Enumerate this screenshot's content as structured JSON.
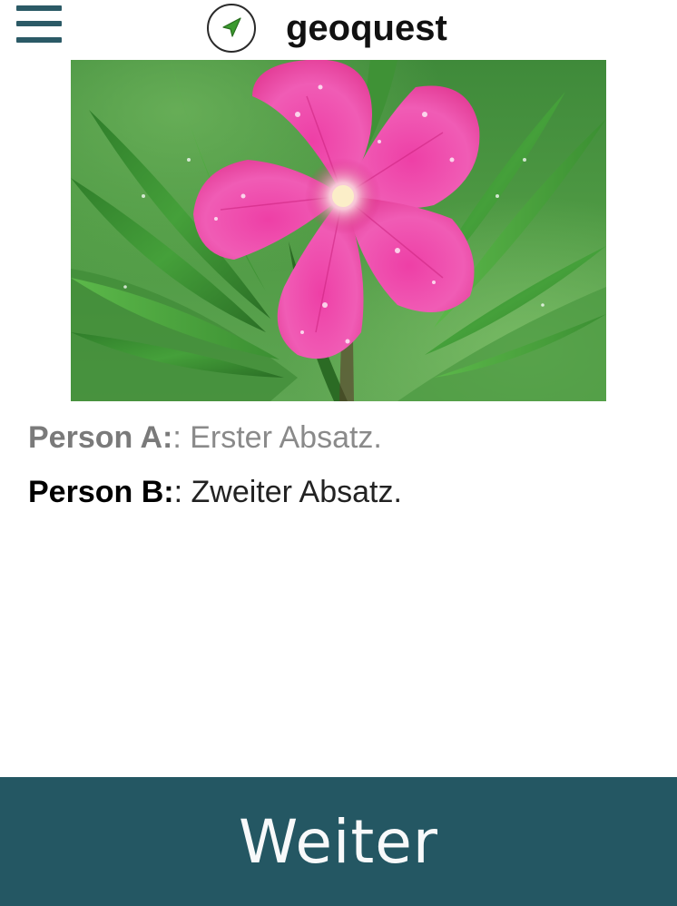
{
  "header": {
    "app_name": "geoquest",
    "menu_icon": "hamburger-menu-icon",
    "logo_icon": "navigation-arrow-icon"
  },
  "image": {
    "subject": "pink oleander flower with water droplets and green leaves"
  },
  "dialog": {
    "lines": [
      {
        "speaker": "Person A:",
        "separator": ": ",
        "text": "Erster Absatz.",
        "state": "faded"
      },
      {
        "speaker": "Person B:",
        "separator": ": ",
        "text": "Zweiter Absatz.",
        "state": "active"
      }
    ]
  },
  "footer": {
    "next_label": "Weiter"
  },
  "colors": {
    "primary": "#245763",
    "menu": "#2b5a66",
    "logo_arrow": "#3a9a2e",
    "text_active": "#222222",
    "text_faded": "#8a8a8a"
  }
}
